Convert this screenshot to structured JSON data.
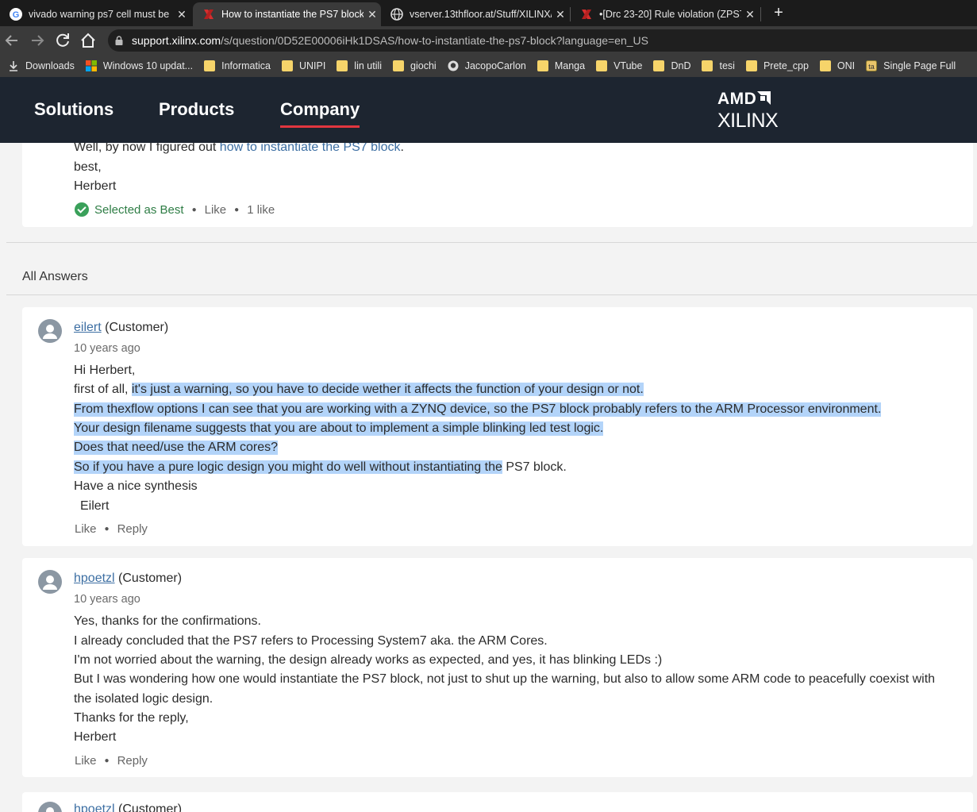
{
  "browser": {
    "tabs": [
      {
        "title": "vivado warning ps7 cell must be",
        "icon": "google-icon",
        "active": false
      },
      {
        "title": "How to instantiate the PS7 block",
        "icon": "xilinx-icon",
        "active": true
      },
      {
        "title": "vserver.13thfloor.at/Stuff/XILINX/",
        "icon": "globe-icon",
        "active": false
      },
      {
        "title": "•[Drc 23-20] Rule violation (ZPS7",
        "icon": "xilinx-icon",
        "active": false
      }
    ],
    "close_glyph": "✕",
    "new_tab_glyph": "+",
    "url_host": "support.xilinx.com",
    "url_path": "/s/question/0D52E00006iHk1DSAS/how-to-instantiate-the-ps7-block?language=en_US",
    "bookmarks": [
      {
        "label": "Downloads",
        "icon": "download-icon"
      },
      {
        "label": "Windows 10 updat...",
        "icon": "windows-icon"
      },
      {
        "label": "Informatica",
        "icon": "folder-icon"
      },
      {
        "label": "UNIPI",
        "icon": "folder-icon"
      },
      {
        "label": "lin utili",
        "icon": "folder-icon"
      },
      {
        "label": "giochi",
        "icon": "folder-icon"
      },
      {
        "label": "JacopoCarlon",
        "icon": "github-icon"
      },
      {
        "label": "Manga",
        "icon": "folder-icon"
      },
      {
        "label": "VTube",
        "icon": "folder-icon"
      },
      {
        "label": "DnD",
        "icon": "folder-icon"
      },
      {
        "label": "tesi",
        "icon": "folder-icon"
      },
      {
        "label": "Prete_cpp",
        "icon": "folder-icon"
      },
      {
        "label": "ONI",
        "icon": "folder-icon"
      },
      {
        "label": "Single Page Full",
        "icon": "app-icon"
      }
    ]
  },
  "site": {
    "nav": [
      "Solutions",
      "Products",
      "Company"
    ],
    "logo_amd": "AMD",
    "logo_xilinx": "XILINX"
  },
  "best_answer": {
    "line1_prefix": "Well, by now I figured out ",
    "line1_link": "how to instantiate the PS7 block",
    "line1_suffix": ".",
    "line2": "best,",
    "line3": "Herbert",
    "selected_label": "Selected as Best",
    "like_label": "Like",
    "likes_count": "1 like"
  },
  "all_answers_label": "All Answers",
  "answers": [
    {
      "author": "eilert",
      "role": "(Customer)",
      "time": "10 years ago",
      "greeting": "Hi Herbert,",
      "l2_plain": "first of all, ",
      "l2_hl": "it's just a warning, so you have to decide wether it affects the function of your design or not.",
      "l3": "From thexflow options I can see that you are working with a ZYNQ device, so the PS7 block probably refers to the ARM Processor environment.",
      "l4": "Your design filename suggests that you are about to implement a simple blinking led test logic.",
      "l5": "Does that need/use the ARM cores?",
      "l6_hl": "So if you have a pure logic design you might do well without instantiating the",
      "l6_plain": " PS7 block.",
      "l7": "Have a nice synthesis",
      "l8": "Eilert",
      "like": "Like",
      "reply": "Reply"
    },
    {
      "author": "hpoetzl",
      "role": "(Customer)",
      "time": "10 years ago",
      "l1": "Yes, thanks for the confirmations.",
      "l2": "I already concluded that the PS7 refers to Processing System7 aka. the ARM Cores.",
      "l3": "I'm not worried about the warning, the design already works as expected, and yes, it has blinking LEDs :)",
      "l4": "But I was wondering how one would instantiate the PS7 block, not just to shut up the warning, but also to allow some ARM code to peacefully coexist with",
      "l5": "the isolated logic design.",
      "l6": "Thanks for the reply,",
      "l7": "Herbert",
      "like": "Like",
      "reply": "Reply"
    },
    {
      "author": "hpoetzl",
      "role": "(Customer)"
    }
  ],
  "colors": {
    "highlight": "#b3d4f9",
    "link": "#3d6fa3",
    "header_bg": "#1d2530",
    "nav_underline": "#e2363f",
    "best_green": "#3aa05a"
  }
}
